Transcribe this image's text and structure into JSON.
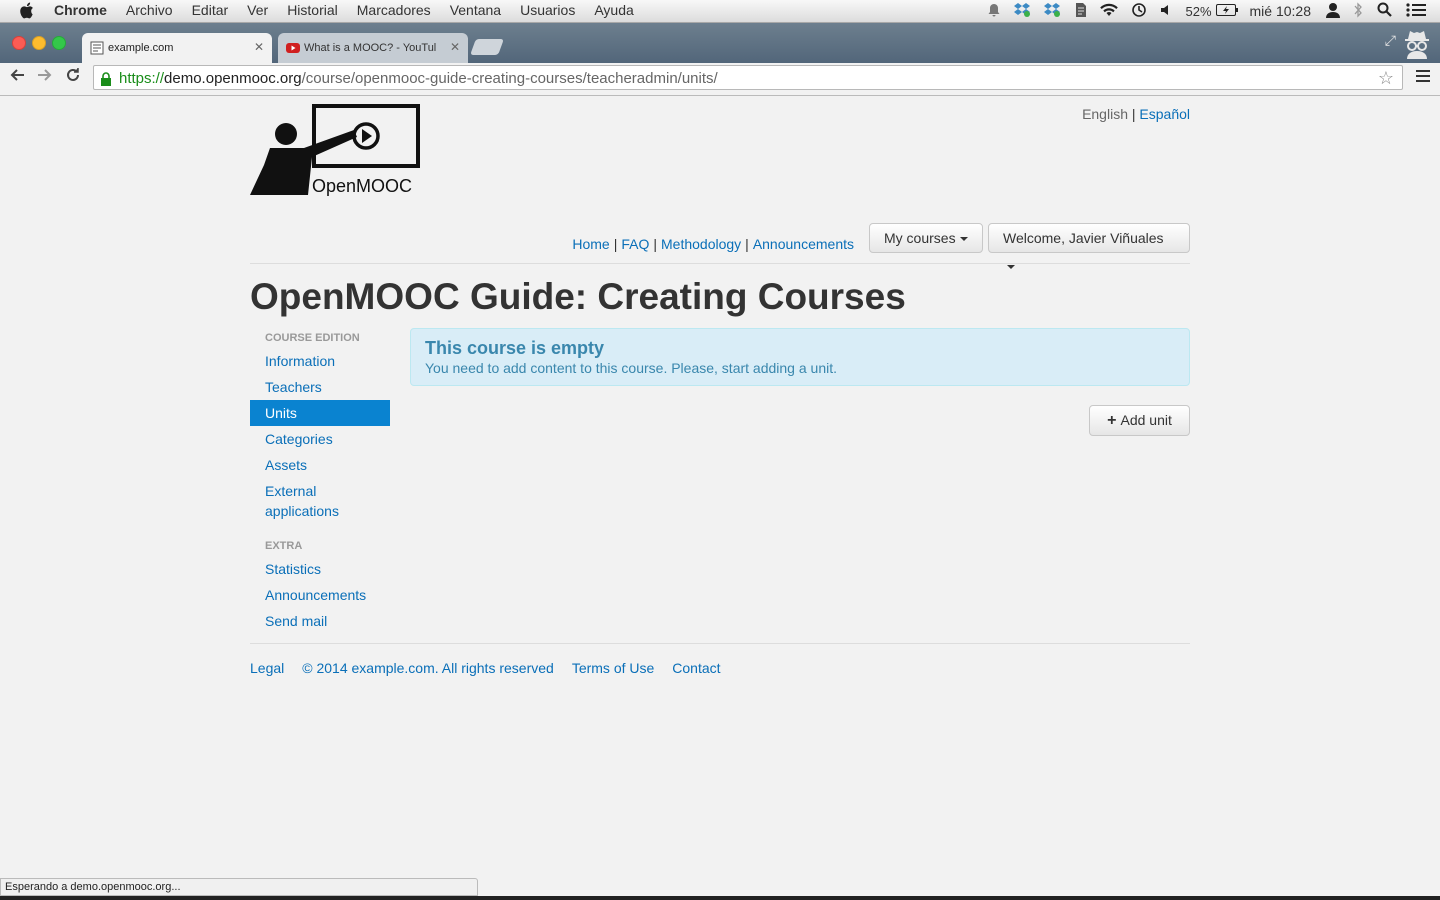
{
  "menubar": {
    "app": "Chrome",
    "items": [
      "Archivo",
      "Editar",
      "Ver",
      "Historial",
      "Marcadores",
      "Ventana",
      "Usuarios",
      "Ayuda"
    ],
    "battery": "52%",
    "clock": "mié 10:28"
  },
  "tabs": [
    {
      "title": "example.com"
    },
    {
      "title": "What is a MOOC? - YouTul"
    }
  ],
  "omnibox": {
    "scheme": "https://",
    "host": "demo.openmooc.org",
    "path": "/course/openmooc-guide-creating-courses/teacheradmin/units/"
  },
  "logo": {
    "text": "OpenMOOC"
  },
  "lang": {
    "current": "English",
    "other": "Español"
  },
  "topnav": {
    "items": [
      "Home",
      "FAQ",
      "Methodology",
      "Announcements"
    ]
  },
  "dropdowns": {
    "courses": "My courses",
    "user": "Welcome, Javier Viñuales"
  },
  "page_title": "OpenMOOC Guide: Creating Courses",
  "sidebar": {
    "header1": "COURSE EDITION",
    "items1": [
      "Information",
      "Teachers",
      "Units",
      "Categories",
      "Assets",
      "External applications"
    ],
    "active": "Units",
    "header2": "EXTRA",
    "items2": [
      "Statistics",
      "Announcements",
      "Send mail"
    ]
  },
  "alert": {
    "heading": "This course is empty",
    "text": "You need to add content to this course. Please, start adding a unit."
  },
  "add_unit": "Add unit",
  "footer": {
    "legal": "Legal",
    "copyright": "© 2014 example.com. All rights reserved",
    "terms": "Terms of Use",
    "contact": "Contact"
  },
  "status_text": "Esperando a demo.openmooc.org..."
}
